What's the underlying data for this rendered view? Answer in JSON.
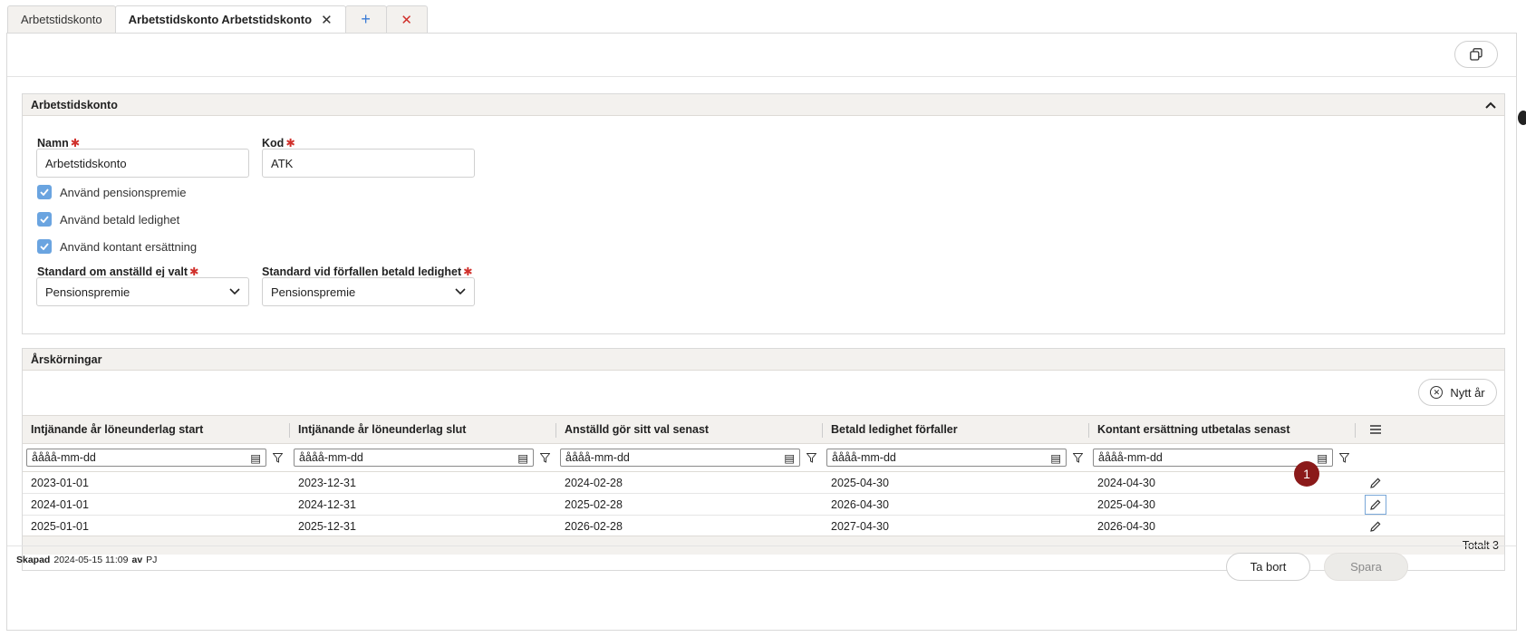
{
  "tabs": [
    {
      "label": "Arbetstidskonto"
    },
    {
      "label": "Arbetstidskonto Arbetstidskonto",
      "active": true
    }
  ],
  "section_general": {
    "title": "Arbetstidskonto",
    "name_label": "Namn",
    "name_value": "Arbetstidskonto",
    "code_label": "Kod",
    "code_value": "ATK",
    "checkboxes": [
      {
        "label": "Använd pensionspremie",
        "checked": true
      },
      {
        "label": "Använd betald ledighet",
        "checked": true
      },
      {
        "label": "Använd kontant ersättning",
        "checked": true
      }
    ],
    "default_not_chosen_label": "Standard om anställd ej valt",
    "default_not_chosen_value": "Pensionspremie",
    "default_expired_label": "Standard vid förfallen betald ledighet",
    "default_expired_value": "Pensionspremie"
  },
  "section_runs": {
    "title": "Årskörningar",
    "new_year_label": "Nytt år",
    "columns": [
      "Intjänande år löneunderlag start",
      "Intjänande år löneunderlag slut",
      "Anställd gör sitt val senast",
      "Betald ledighet förfaller",
      "Kontant ersättning utbetalas senast"
    ],
    "filter_placeholder": "åååå-mm-dd",
    "rows": [
      [
        "2023-01-01",
        "2023-12-31",
        "2024-02-28",
        "2025-04-30",
        "2024-04-30"
      ],
      [
        "2024-01-01",
        "2024-12-31",
        "2025-02-28",
        "2026-04-30",
        "2025-04-30"
      ],
      [
        "2025-01-01",
        "2025-12-31",
        "2026-02-28",
        "2027-04-30",
        "2026-04-30"
      ]
    ],
    "total_label": "Totalt 3",
    "badge": "1"
  },
  "footer": {
    "created_label": "Skapad",
    "created_date": "2024-05-15 11:09",
    "by_label": "av",
    "by_user": "PJ",
    "delete_label": "Ta bort",
    "save_label": "Spara"
  },
  "colors": {
    "accent": "#6aa4e0",
    "required": "#d0302b",
    "badge": "#8b1a1a",
    "header_bg": "#f3f1ee"
  }
}
